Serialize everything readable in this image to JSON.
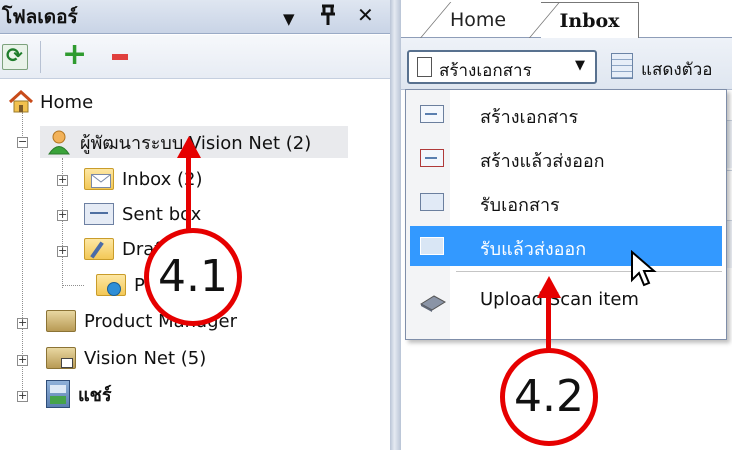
{
  "left_pane": {
    "title": "โฟลเดอร์",
    "header_buttons": {
      "dropdown": "▼",
      "pin": "ᵽ",
      "close": "✕"
    },
    "toolbar": {
      "refresh_icon": "refresh-icon",
      "add_icon": "plus-icon",
      "remove_icon": "minus-icon"
    }
  },
  "tree": {
    "home": "Home",
    "user": "ผู้พัฒนาระบบ Vision Net (2)",
    "inbox": "Inbox (2)",
    "sent": "Sent box",
    "draft": "Draft box",
    "public": "Public",
    "product": "Product Manager",
    "visionnet": "Vision Net (5)",
    "share": "แชร์"
  },
  "right_pane": {
    "tabs": {
      "home": "Home",
      "inbox": "Inbox"
    },
    "create_doc": "สร้างเอกสาร",
    "create_doc_arrow": "▼",
    "show_columns": "แสดงตัวอ"
  },
  "menu": {
    "items": [
      {
        "label": "สร้างเอกสาร",
        "icon": "new-document-icon"
      },
      {
        "label": "สร้างแล้วส่งออก",
        "icon": "create-send-icon"
      },
      {
        "label": "รับเอกสาร",
        "icon": "receive-document-icon"
      },
      {
        "label": "รับแล้วส่งออก",
        "icon": "receive-forward-icon",
        "highlighted": true
      },
      {
        "label": "Upload Scan item",
        "icon": "scanner-icon"
      }
    ]
  },
  "annotations": {
    "a1": "4.1",
    "a2": "4.2"
  },
  "colors": {
    "highlight": "#3399ff",
    "annotation_red": "#e60000"
  }
}
